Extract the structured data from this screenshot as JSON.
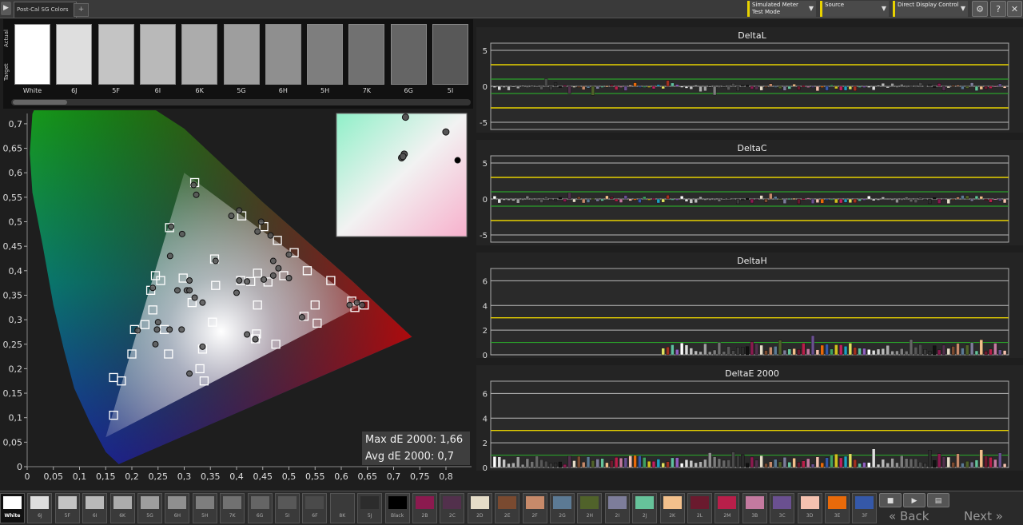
{
  "tabs": {
    "active": "Post-Cal SG Colors",
    "add": "+"
  },
  "toolbar": {
    "meter_line1": "Simulated Meter",
    "meter_line2": "Test Mode",
    "source": "Source",
    "display": "Direct Display Control",
    "settings_icon": "gear-icon",
    "help": "?",
    "close": "✕"
  },
  "strip": {
    "actual_label": "Actual",
    "target_label": "Target",
    "patches": [
      {
        "label": "White",
        "color": "#ffffff"
      },
      {
        "label": "6J",
        "color": "#dedede"
      },
      {
        "label": "5F",
        "color": "#c4c4c4"
      },
      {
        "label": "6I",
        "color": "#b9b9b9"
      },
      {
        "label": "6K",
        "color": "#acacac"
      },
      {
        "label": "5G",
        "color": "#9e9e9e"
      },
      {
        "label": "6H",
        "color": "#8f8f8f"
      },
      {
        "label": "5H",
        "color": "#7e7e7e"
      },
      {
        "label": "7K",
        "color": "#717171"
      },
      {
        "label": "6G",
        "color": "#656565"
      },
      {
        "label": "5I",
        "color": "#585858"
      }
    ]
  },
  "cie": {
    "x_ticks": [
      "0",
      "0,05",
      "0,1",
      "0,15",
      "0,2",
      "0,25",
      "0,3",
      "0,35",
      "0,4",
      "0,45",
      "0,5",
      "0,55",
      "0,6",
      "0,65",
      "0,7",
      "0,75",
      "0,8"
    ],
    "y_ticks": [
      "0",
      "0,05",
      "0,1",
      "0,15",
      "0,2",
      "0,25",
      "0,3",
      "0,35",
      "0,4",
      "0,45",
      "0,5",
      "0,55",
      "0,6",
      "0,65",
      "0,7"
    ],
    "targets": [
      [
        0.32,
        0.58
      ],
      [
        0.272,
        0.488
      ],
      [
        0.41,
        0.512
      ],
      [
        0.452,
        0.49
      ],
      [
        0.478,
        0.462
      ],
      [
        0.51,
        0.437
      ],
      [
        0.358,
        0.424
      ],
      [
        0.44,
        0.395
      ],
      [
        0.535,
        0.4
      ],
      [
        0.58,
        0.38
      ],
      [
        0.36,
        0.37
      ],
      [
        0.49,
        0.39
      ],
      [
        0.427,
        0.378
      ],
      [
        0.46,
        0.377
      ],
      [
        0.408,
        0.38
      ],
      [
        0.255,
        0.38
      ],
      [
        0.236,
        0.36
      ],
      [
        0.24,
        0.32
      ],
      [
        0.225,
        0.29
      ],
      [
        0.262,
        0.28
      ],
      [
        0.205,
        0.28
      ],
      [
        0.2,
        0.23
      ],
      [
        0.27,
        0.23
      ],
      [
        0.315,
        0.335
      ],
      [
        0.354,
        0.295
      ],
      [
        0.44,
        0.33
      ],
      [
        0.55,
        0.33
      ],
      [
        0.529,
        0.307
      ],
      [
        0.554,
        0.293
      ],
      [
        0.62,
        0.338
      ],
      [
        0.626,
        0.325
      ],
      [
        0.644,
        0.33
      ],
      [
        0.438,
        0.271
      ],
      [
        0.436,
        0.261
      ],
      [
        0.475,
        0.25
      ],
      [
        0.335,
        0.24
      ],
      [
        0.33,
        0.2
      ],
      [
        0.338,
        0.175
      ],
      [
        0.18,
        0.175
      ],
      [
        0.165,
        0.182
      ],
      [
        0.165,
        0.105
      ],
      [
        0.298,
        0.385
      ],
      [
        0.245,
        0.39
      ]
    ],
    "measured": [
      [
        0.318,
        0.575
      ],
      [
        0.323,
        0.555
      ],
      [
        0.275,
        0.49
      ],
      [
        0.39,
        0.512
      ],
      [
        0.405,
        0.523
      ],
      [
        0.447,
        0.5
      ],
      [
        0.465,
        0.472
      ],
      [
        0.44,
        0.48
      ],
      [
        0.5,
        0.433
      ],
      [
        0.36,
        0.42
      ],
      [
        0.405,
        0.38
      ],
      [
        0.42,
        0.378
      ],
      [
        0.48,
        0.405
      ],
      [
        0.47,
        0.39
      ],
      [
        0.5,
        0.385
      ],
      [
        0.452,
        0.382
      ],
      [
        0.4,
        0.355
      ],
      [
        0.31,
        0.38
      ],
      [
        0.305,
        0.36
      ],
      [
        0.287,
        0.36
      ],
      [
        0.24,
        0.365
      ],
      [
        0.25,
        0.295
      ],
      [
        0.272,
        0.28
      ],
      [
        0.295,
        0.28
      ],
      [
        0.211,
        0.278
      ],
      [
        0.248,
        0.28
      ],
      [
        0.32,
        0.345
      ],
      [
        0.335,
        0.335
      ],
      [
        0.335,
        0.245
      ],
      [
        0.42,
        0.27
      ],
      [
        0.436,
        0.26
      ],
      [
        0.31,
        0.19
      ],
      [
        0.525,
        0.305
      ],
      [
        0.616,
        0.33
      ],
      [
        0.63,
        0.335
      ],
      [
        0.64,
        0.33
      ],
      [
        0.273,
        0.43
      ],
      [
        0.296,
        0.475
      ],
      [
        0.31,
        0.36
      ],
      [
        0.245,
        0.25
      ],
      [
        0.47,
        0.42
      ]
    ],
    "inset_points": [
      [
        0.53,
        0.97
      ],
      [
        0.52,
        0.67
      ],
      [
        0.5,
        0.64
      ],
      [
        0.51,
        0.65
      ],
      [
        0.84,
        0.85
      ],
      [
        0.93,
        0.62
      ]
    ],
    "gamut_primaries": [
      [
        0.64,
        0.33
      ],
      [
        0.3,
        0.6
      ],
      [
        0.15,
        0.06
      ]
    ]
  },
  "stats": {
    "max": "Max dE 2000: 1,66",
    "avg": "Avg dE 2000: 0,7"
  },
  "plots": [
    {
      "title": "DeltaL",
      "y_ticks": [
        "5",
        "0",
        "-5"
      ],
      "ymin": -6,
      "ymax": 6,
      "bipolar": true,
      "limits": [
        3,
        -3
      ],
      "good": [
        1,
        -1
      ]
    },
    {
      "title": "DeltaC",
      "y_ticks": [
        "5",
        "0",
        "-5"
      ],
      "ymin": -6,
      "ymax": 6,
      "bipolar": true,
      "limits": [
        3,
        -3
      ],
      "good": [
        1,
        -1
      ]
    },
    {
      "title": "DeltaH",
      "y_ticks": [
        "6",
        "4",
        "2",
        "0"
      ],
      "ymin": 0,
      "ymax": 7,
      "bipolar": false,
      "limits": [
        3
      ],
      "good": [
        1
      ]
    },
    {
      "title": "DeltaE 2000",
      "y_ticks": [
        "6",
        "4",
        "2",
        "0"
      ],
      "ymin": 0,
      "ymax": 7,
      "bipolar": false,
      "limits": [
        3
      ],
      "good": [
        1
      ]
    }
  ],
  "bottom": {
    "swatches": [
      {
        "label": "White",
        "color": "#ffffff"
      },
      {
        "label": "6J",
        "color": "#dedede"
      },
      {
        "label": "5F",
        "color": "#c4c4c4"
      },
      {
        "label": "6I",
        "color": "#b9b9b9"
      },
      {
        "label": "6K",
        "color": "#acacac"
      },
      {
        "label": "5G",
        "color": "#9e9e9e"
      },
      {
        "label": "6H",
        "color": "#8f8f8f"
      },
      {
        "label": "5H",
        "color": "#7e7e7e"
      },
      {
        "label": "7K",
        "color": "#717171"
      },
      {
        "label": "6G",
        "color": "#656565"
      },
      {
        "label": "5I",
        "color": "#585858"
      },
      {
        "label": "6F",
        "color": "#4a4a4a"
      },
      {
        "label": "8K",
        "color": "#3a3a3a"
      },
      {
        "label": "5J",
        "color": "#2c2c2c"
      },
      {
        "label": "Black",
        "color": "#000000"
      },
      {
        "label": "2B",
        "color": "#8b1a4f"
      },
      {
        "label": "2C",
        "color": "#52304c"
      },
      {
        "label": "2D",
        "color": "#e5dcc8"
      },
      {
        "label": "2E",
        "color": "#7a4a30"
      },
      {
        "label": "2F",
        "color": "#c78a6a"
      },
      {
        "label": "2G",
        "color": "#5c7a94"
      },
      {
        "label": "2H",
        "color": "#50622a"
      },
      {
        "label": "2I",
        "color": "#7d7d9a"
      },
      {
        "label": "2J",
        "color": "#66c29a"
      },
      {
        "label": "2K",
        "color": "#f3c08c"
      },
      {
        "label": "2L",
        "color": "#6a1a2e"
      },
      {
        "label": "2M",
        "color": "#b81f4a"
      },
      {
        "label": "3B",
        "color": "#c47aa0"
      },
      {
        "label": "3C",
        "color": "#6a5090"
      },
      {
        "label": "3D",
        "color": "#f5c2b0"
      },
      {
        "label": "3E",
        "color": "#e86a0a"
      },
      {
        "label": "3F",
        "color": "#3558a8"
      }
    ],
    "back": "Back",
    "next": "Next"
  }
}
